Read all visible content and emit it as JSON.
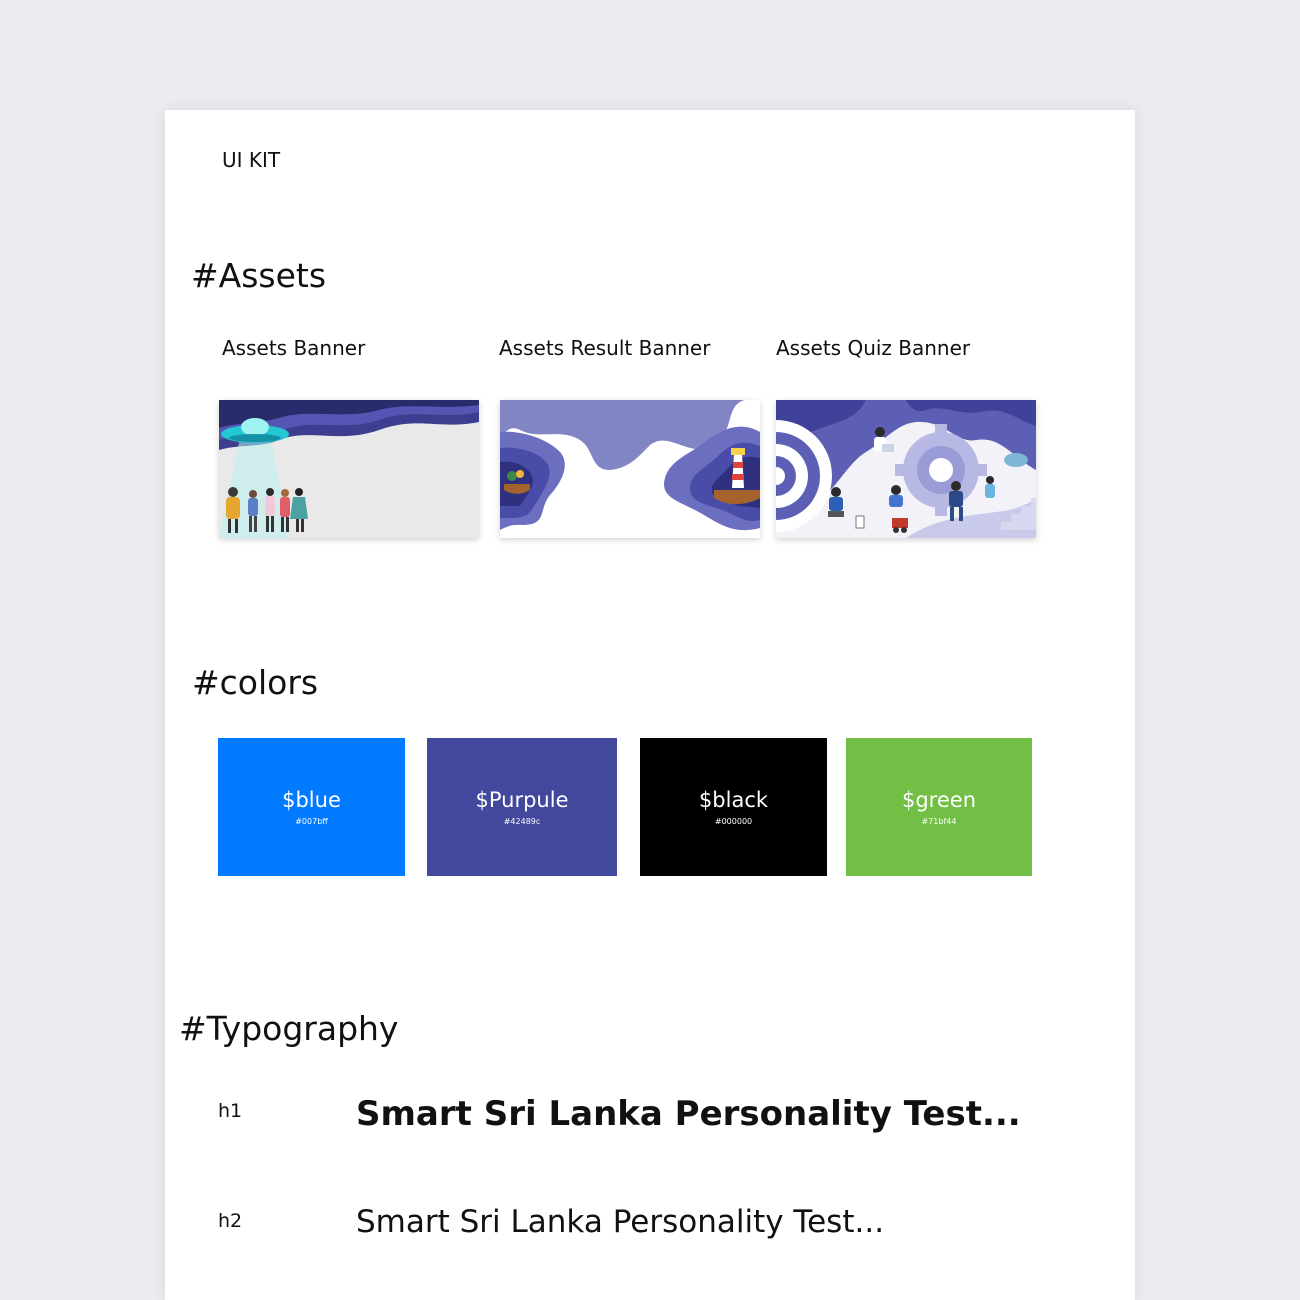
{
  "kit": {
    "title": "UI KIT"
  },
  "sections": {
    "assets": "#Assets",
    "colors": "#colors",
    "typography": "#Typography"
  },
  "banners": [
    {
      "label": "Assets Banner"
    },
    {
      "label": "Assets Result Banner"
    },
    {
      "label": "Assets Quiz Banner"
    }
  ],
  "colors": [
    {
      "name": "$blue",
      "hex": "#007bff"
    },
    {
      "name": "$Purpule",
      "hex": "#42489c"
    },
    {
      "name": "$black",
      "hex": "#000000"
    },
    {
      "name": "$green",
      "hex": "#71bf44"
    }
  ],
  "typography": [
    {
      "tag": "h1",
      "sample": "Smart Sri Lanka Personality Test..."
    },
    {
      "tag": "h2",
      "sample": "Smart Sri Lanka Personality Test..."
    }
  ]
}
